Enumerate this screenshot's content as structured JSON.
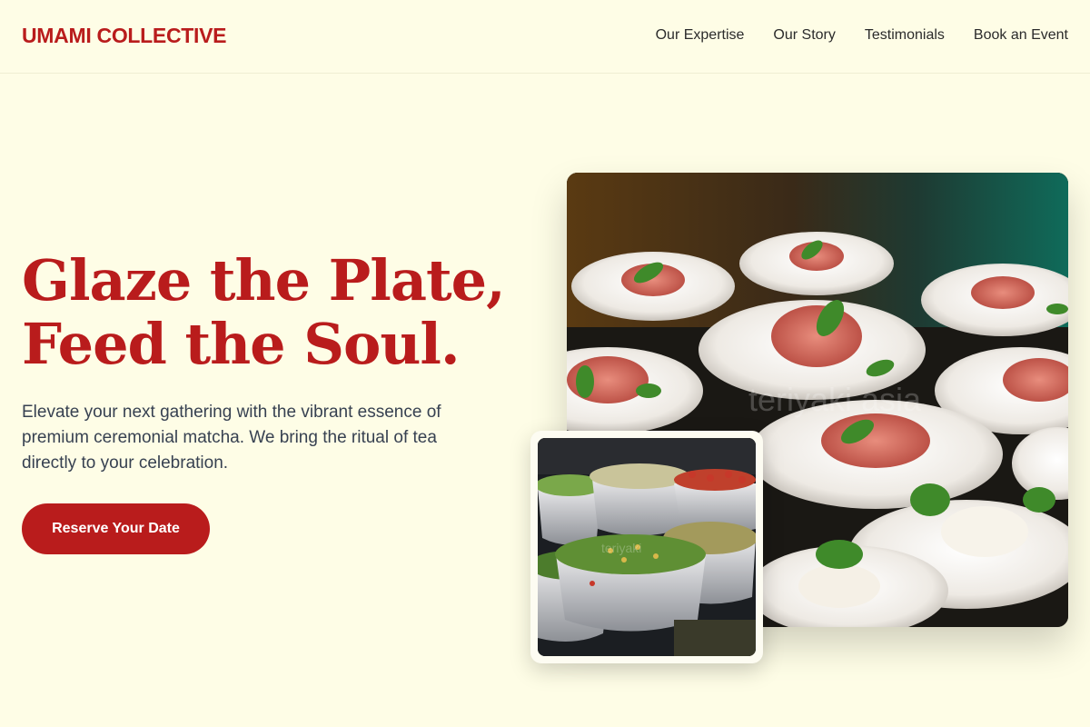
{
  "header": {
    "brand": "UMAMI COLLECTIVE",
    "nav": [
      "Our Expertise",
      "Our Story",
      "Testimonials",
      "Book an Event"
    ]
  },
  "hero": {
    "title_line1": "Glaze the Plate,",
    "title_line2": "Feed the Soul.",
    "description": "Elevate your next gathering with the vibrant essence of premium ceremonial matcha. We bring the ritual of tea directly to your celebration.",
    "cta_label": "Reserve Your Date"
  },
  "images": {
    "main_watermark": "teriyaki asia",
    "inset_watermark": "teriyaki"
  },
  "colors": {
    "background": "#fefde6",
    "accent": "#b91c1c",
    "text": "#374151"
  }
}
